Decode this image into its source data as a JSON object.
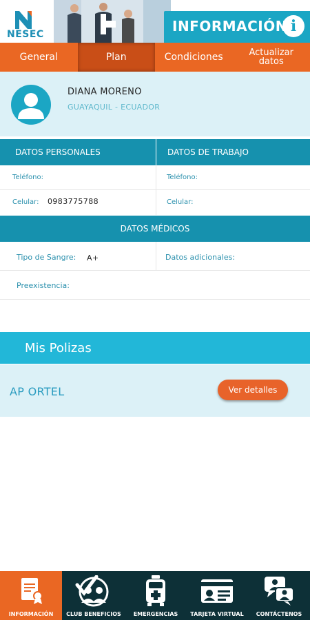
{
  "header": {
    "logo_text": "NESEC",
    "title": "INFORMACIÓN",
    "info_icon": "info-icon",
    "accent": "#1ba6c4"
  },
  "tabs": [
    {
      "label": "General",
      "active": false
    },
    {
      "label": "Plan",
      "active": true
    },
    {
      "label": "Condiciones",
      "active": false
    },
    {
      "label_line1": "Actualizar",
      "label_line2": "datos",
      "active": false
    }
  ],
  "profile": {
    "name": "DIANA MORENO",
    "location": "GUAYAQUIL - ECUADOR"
  },
  "personal": {
    "section_title": "DATOS PERSONALES",
    "phone_label": "Teléfono:",
    "phone_value": "",
    "mobile_label": "Celular:",
    "mobile_value": "0983775788"
  },
  "trabajo": {
    "section_title": "DATOS DE TRABAJO",
    "phone_label": "Teléfono:",
    "phone_value": "",
    "mobile_label": "Celular:",
    "mobile_value": ""
  },
  "medicos": {
    "section_title": "DATOS MÉDICOS",
    "blood_label": "Tipo de Sangre:",
    "blood_value": "A+",
    "additional_label": "Datos adicionales:",
    "preexisting_label": "Preexistencia:"
  },
  "polizas": {
    "title": "Mis Polizas",
    "items": [
      {
        "name": "AP ORTEL",
        "button_label": "Ver detalles"
      }
    ]
  },
  "bottom_nav": [
    {
      "label": "INFORMACIÓN",
      "icon": "document-icon",
      "active": true
    },
    {
      "label": "CLUB BENEFICIOS",
      "icon": "club-icon",
      "active": false
    },
    {
      "label": "EMERGENCIAS",
      "icon": "ambulance-icon",
      "active": false
    },
    {
      "label": "TARJETA VIRTUAL",
      "icon": "id-card-icon",
      "active": false
    },
    {
      "label": "CONTÁCTENOS",
      "icon": "chat-icon",
      "active": false
    }
  ],
  "colors": {
    "orange": "#ea6723",
    "teal_dark": "#1691ae",
    "teal_light": "#22b7d8",
    "light_bg": "#dcf1f7",
    "nav_bg": "#0d3037"
  }
}
